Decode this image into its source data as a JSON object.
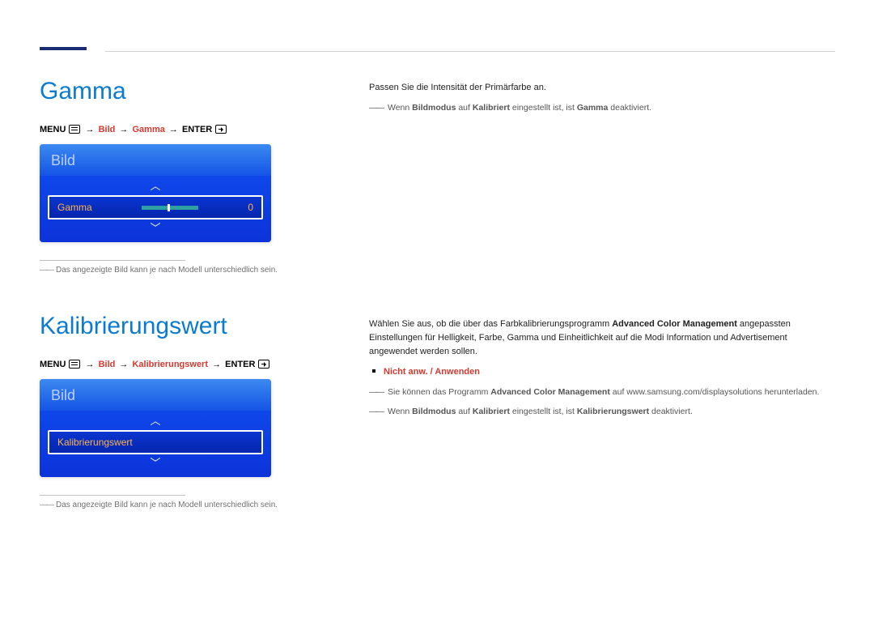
{
  "gamma": {
    "title": "Gamma",
    "breadcrumb": {
      "menu": "MENU",
      "path1": "Bild",
      "path2": "Gamma",
      "enter": "ENTER"
    },
    "osd": {
      "header": "Bild",
      "row_label": "Gamma",
      "row_value": "0"
    },
    "footnote": "Das angezeigte Bild kann je nach Modell unterschiedlich sein.",
    "desc": "Passen Sie die Intensität der Primärfarbe an.",
    "note_prefix": "Wenn ",
    "note_b1": "Bildmodus",
    "note_mid1": " auf ",
    "note_b2": "Kalibriert",
    "note_mid2": " eingestellt ist, ist ",
    "note_b3": "Gamma",
    "note_suffix": " deaktiviert."
  },
  "cal": {
    "title": "Kalibrierungswert",
    "breadcrumb": {
      "menu": "MENU",
      "path1": "Bild",
      "path2": "Kalibrierungswert",
      "enter": "ENTER"
    },
    "osd": {
      "header": "Bild",
      "row_label": "Kalibrierungswert"
    },
    "footnote": "Das angezeigte Bild kann je nach Modell unterschiedlich sein.",
    "desc_p1": "Wählen Sie aus, ob die über das Farbkalibrierungsprogramm ",
    "desc_b1": "Advanced Color Management",
    "desc_p2": " angepassten Einstellungen für Helligkeit, Farbe, Gamma und Einheitlichkeit auf die Modi Information und Advertisement angewendet werden sollen.",
    "options": "Nicht anw. / Anwenden",
    "dl_note_p1": "Sie können das Programm ",
    "dl_note_b1": "Advanced Color Management",
    "dl_note_p2": " auf www.samsung.com/displaysolutions herunterladen.",
    "note2_prefix": "Wenn ",
    "note2_b1": "Bildmodus",
    "note2_mid1": " auf ",
    "note2_b2": "Kalibriert",
    "note2_mid2": " eingestellt ist, ist ",
    "note2_b3": "Kalibrierungswert",
    "note2_suffix": " deaktiviert."
  }
}
